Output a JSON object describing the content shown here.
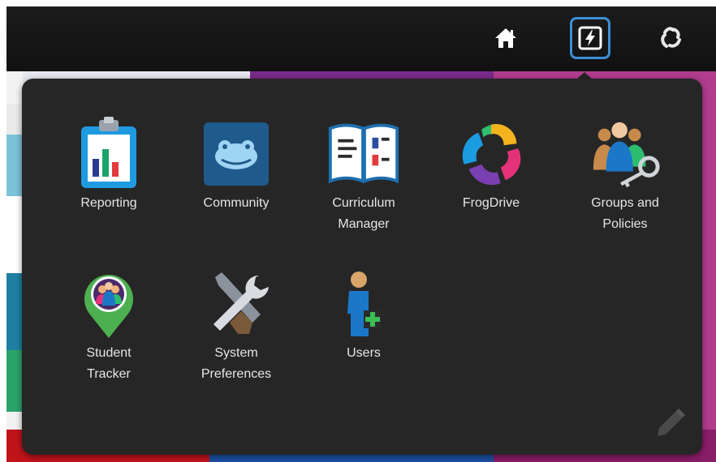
{
  "topbar": {
    "icons": [
      "home-icon",
      "apps-icon",
      "frog-icon"
    ]
  },
  "apps": [
    {
      "label": "Reporting",
      "icon": "reporting-icon"
    },
    {
      "label": "Community",
      "icon": "community-icon"
    },
    {
      "label": "Curriculum\nManager",
      "icon": "curriculum-manager-icon"
    },
    {
      "label": "FrogDrive",
      "icon": "frogdrive-icon"
    },
    {
      "label": "Groups and\nPolicies",
      "icon": "groups-policies-icon"
    },
    {
      "label": "Student\nTracker",
      "icon": "student-tracker-icon"
    },
    {
      "label": "System\nPreferences",
      "icon": "system-preferences-icon"
    },
    {
      "label": "Users",
      "icon": "users-icon"
    }
  ],
  "panel": {
    "edit_icon": "pencil-icon"
  },
  "colors": {
    "topbar": "#141414",
    "panel": "#262626",
    "active_outline": "#3b8fd6",
    "label_text": "#e6e6e6"
  }
}
